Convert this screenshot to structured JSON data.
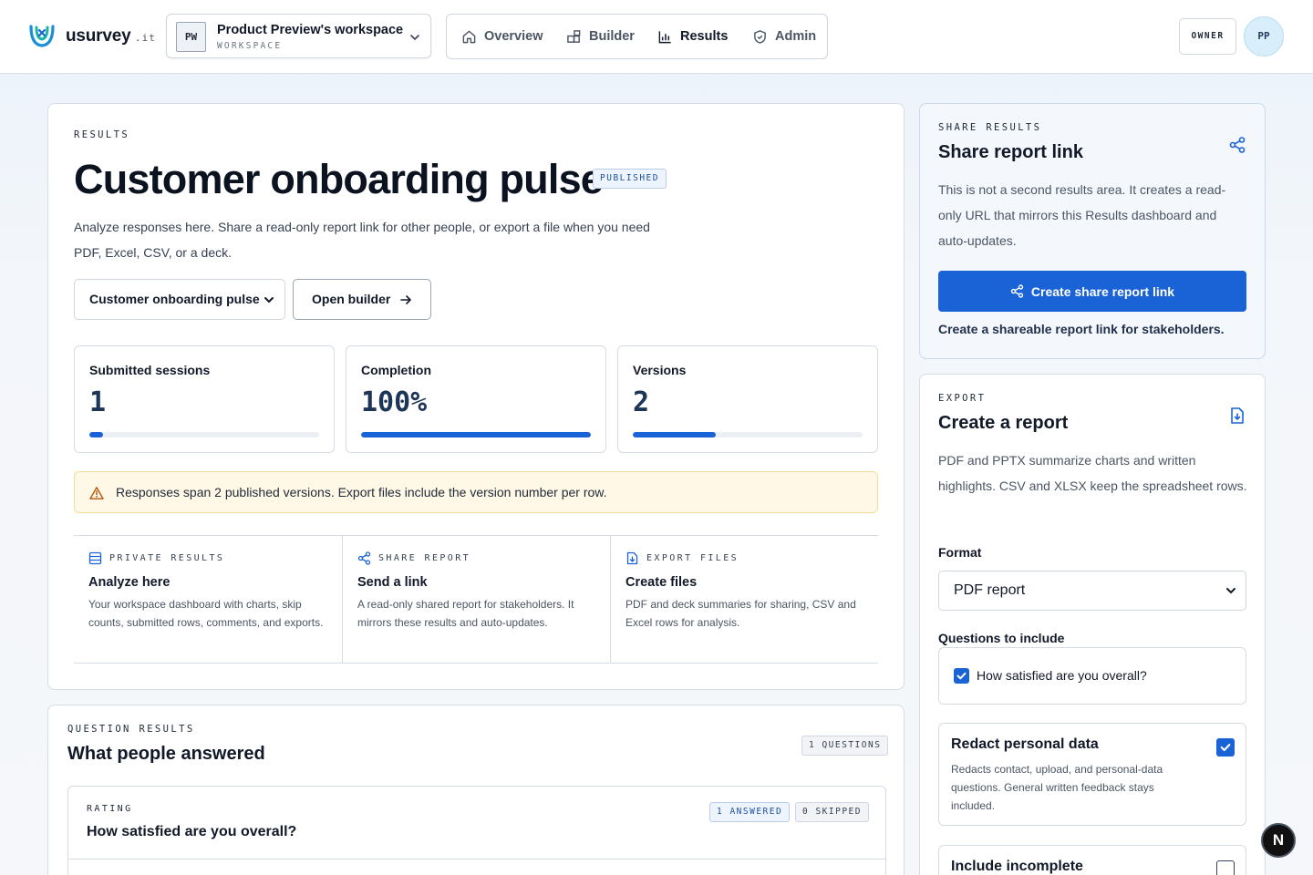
{
  "brand": {
    "name": "usurvey",
    "tld": ".it"
  },
  "workspace": {
    "initials": "PW",
    "name": "Product Preview's workspace",
    "label": "WORKSPACE"
  },
  "nav": {
    "items": [
      {
        "label": "Overview",
        "icon": "home-icon",
        "active": false
      },
      {
        "label": "Builder",
        "icon": "blocks-icon",
        "active": false
      },
      {
        "label": "Results",
        "icon": "bar-chart-icon",
        "active": true
      },
      {
        "label": "Admin",
        "icon": "shield-icon",
        "active": false
      }
    ]
  },
  "user": {
    "role": "OWNER",
    "initials": "PP"
  },
  "results": {
    "eyebrow": "RESULTS",
    "title": "Customer onboarding pulse",
    "status": "PUBLISHED",
    "description": "Analyze responses here. Share a read-only report link for other people, or export a file when you need PDF, Excel, CSV, or a deck.",
    "survey_select": "Customer onboarding pulse",
    "open_builder": "Open builder",
    "stats": [
      {
        "label": "Submitted sessions",
        "value": "1",
        "progress": 0.06
      },
      {
        "label": "Completion",
        "value": "100%",
        "progress": 1.0
      },
      {
        "label": "Versions",
        "value": "2",
        "progress": 0.36
      }
    ],
    "warning": "Responses span 2 published versions. Export files include the version number per row.",
    "guide": [
      {
        "eyebrow": "PRIVATE RESULTS",
        "icon": "table-icon",
        "title": "Analyze here",
        "desc": "Your workspace dashboard with charts, skip counts, submitted rows, comments, and exports."
      },
      {
        "eyebrow": "SHARE REPORT",
        "icon": "share-icon",
        "title": "Send a link",
        "desc": "A read-only shared report for stakeholders. It mirrors these results and auto-updates."
      },
      {
        "eyebrow": "EXPORT FILES",
        "icon": "file-download-icon",
        "title": "Create files",
        "desc": "PDF and deck summaries for sharing, CSV and Excel rows for analysis."
      }
    ]
  },
  "question_results": {
    "eyebrow": "QUESTION RESULTS",
    "title": "What people answered",
    "count": "1 QUESTIONS",
    "question": {
      "type": "RATING",
      "title": "How satisfied are you overall?",
      "answered": "1 ANSWERED",
      "skipped": "0 SKIPPED"
    }
  },
  "share": {
    "eyebrow": "SHARE RESULTS",
    "title": "Share report link",
    "description": "This is not a second results area. It creates a read-only URL that mirrors this Results dashboard and auto-updates.",
    "button": "Create share report link",
    "note": "Create a shareable report link for stakeholders."
  },
  "export": {
    "eyebrow": "EXPORT",
    "title": "Create a report",
    "description": "PDF and PPTX summarize charts and written highlights. CSV and XLSX keep the spreadsheet rows.",
    "format_label": "Format",
    "format_value": "PDF report",
    "questions_label": "Questions to include",
    "question_option": "How satisfied are you overall?",
    "question_checked": true,
    "redact": {
      "title": "Redact personal data",
      "desc": "Redacts contact, upload, and personal-data questions. General written feedback stays included.",
      "checked": true
    },
    "incomplete": {
      "title": "Include incomplete",
      "checked": false
    }
  },
  "dev_badge": "N",
  "colors": {
    "accent": "#1a63d6",
    "warning_bg": "#fff8e6",
    "share_bg": "#f4f8fd"
  }
}
